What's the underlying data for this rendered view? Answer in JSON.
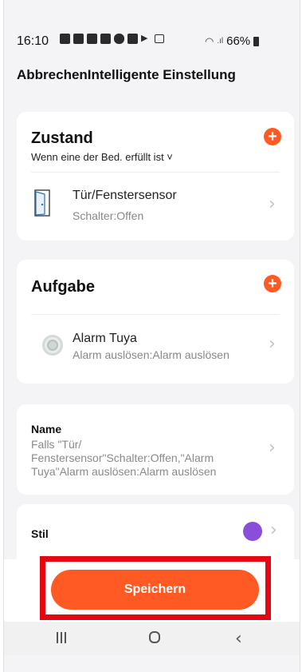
{
  "status_bar": {
    "time": "16:10",
    "battery": "66%"
  },
  "header": {
    "title": "AbbrechenIntelligente Einstellung"
  },
  "condition": {
    "title": "Zustand",
    "add_icon": "+",
    "subtitle": "Wenn eine der Bed. erfüllt ist ˅",
    "item": {
      "title": "Tür/Fenstersensor",
      "subtitle": "Schalter:Offen",
      "icon": "door-icon"
    }
  },
  "task": {
    "title": "Aufgabe",
    "add_icon": "+",
    "item": {
      "title": "Alarm Tuya",
      "subtitle": "Alarm auslösen:Alarm auslösen",
      "icon": "alarm-device-icon"
    }
  },
  "name": {
    "label": "Name",
    "value": "Falls \"Tür/ Fenstersensor\"Schalter:Offen,\"Alarm Tuya\"Alarm auslösen:Alarm auslösen"
  },
  "style": {
    "label": "Stil",
    "color": "#8a4fd8"
  },
  "save_button": {
    "label": "Speichern"
  },
  "colors": {
    "accent": "#ff5a24",
    "highlight": "#e30613"
  }
}
